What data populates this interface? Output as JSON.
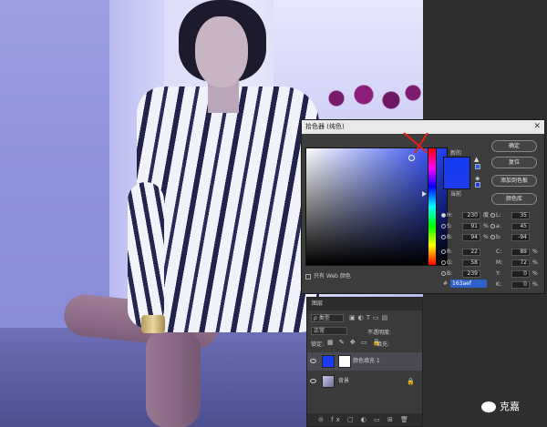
{
  "color_picker": {
    "title": "拾色器 (纯色)",
    "label_new": "新的",
    "label_current": "当前",
    "new_color": "#163aef",
    "current_color": "#1c3bee",
    "buttons": {
      "ok": "确定",
      "reset": "复位",
      "add_swatch": "添加到色板",
      "color_library": "颜色库"
    },
    "values": {
      "H": "230",
      "H_unit": "度",
      "S": "91",
      "S_unit": "%",
      "B": "94",
      "B_unit": "%",
      "R": "22",
      "G": "58",
      "Bv": "239",
      "L": "35",
      "a": "45",
      "b": "-94",
      "C": "89",
      "C_unit": "%",
      "M": "72",
      "M_unit": "%",
      "Y": "0",
      "Y_unit": "%",
      "K": "0",
      "K_unit": "%"
    },
    "web_only_label": "只有 Web 颜色",
    "hex_label": "#",
    "hex_value": "163aef"
  },
  "layers_panel": {
    "tab": "图层",
    "kind_filter": "ρ 类型",
    "blend_mode": "正常",
    "opacity_label": "不透明度:",
    "lock_label": "锁定:",
    "fill_label": "填充:",
    "layers": [
      {
        "name": "颜色填充 1",
        "selected": true
      },
      {
        "name": "背景",
        "selected": false
      }
    ],
    "bottom_icons": "⊝ fx ▢ ◐ ▭ ⊞ 🗑"
  },
  "watermark": {
    "text": "克嘉"
  }
}
